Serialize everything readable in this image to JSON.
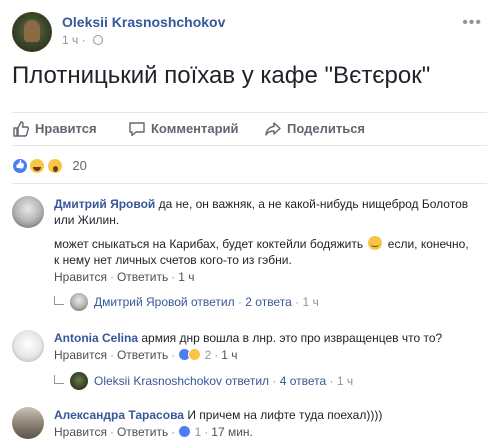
{
  "post": {
    "author": "Oleksii Krasnoshchokov",
    "time": "1 ч",
    "text": "Плотницький поїхав у кафе \"Вєтєрок\""
  },
  "actions": {
    "like": "Нравится",
    "comment": "Комментарий",
    "share": "Поделиться"
  },
  "reactions": {
    "types": [
      "like",
      "haha",
      "wow"
    ],
    "count": "20"
  },
  "comments": [
    {
      "author": "Дмитрий Яровой",
      "text": "да не, он важняк, а не какой-нибудь нищеброд Болотов или Жилин.",
      "text2_before": "может сныкаться на Карибах, будет коктейли бодяжить",
      "text2_after": "если, конечно, к нему нет личных счетов кого-то из гэбни.",
      "like": "Нравится",
      "reply": "Ответить",
      "time": "1 ч",
      "replies": {
        "author": "Дмитрий Яровой",
        "verb": "ответил",
        "count": "2 ответа",
        "time": "1 ч"
      }
    },
    {
      "author": "Antonia Celina",
      "text": "армия днр вошла в лнр. это про извращенцев что то?",
      "like": "Нравится",
      "reply": "Ответить",
      "reaction_count": "2",
      "time": "1 ч",
      "replies": {
        "author": "Oleksii Krasnoshchokov",
        "verb": "ответил",
        "count": "4 ответа",
        "time": "1 ч"
      }
    },
    {
      "author": "Александра Тарасова",
      "text": "И причем на лифте туда поехал))))",
      "like": "Нравится",
      "reply": "Ответить",
      "reaction_count": "1",
      "time": "17 мин."
    }
  ],
  "colors": {
    "link": "#365899",
    "meta": "#90949c",
    "action": "#606770",
    "like_blue": "#4a7ef5",
    "emoji_yellow": "#f7c744"
  }
}
